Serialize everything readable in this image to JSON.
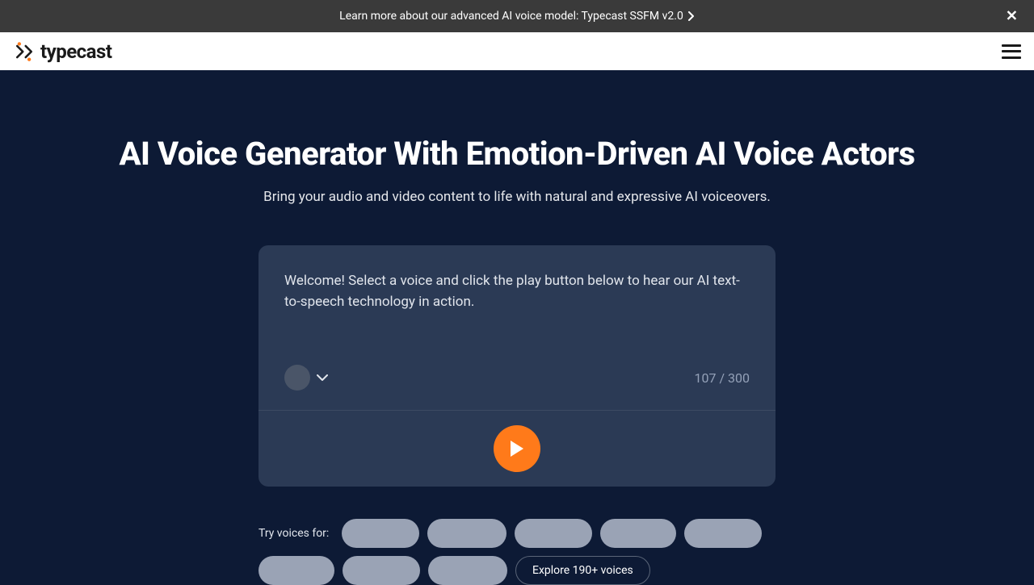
{
  "announcement": {
    "text": "Learn more about our advanced AI voice model: Typecast SSFM v2.0"
  },
  "brand": {
    "name": "typecast"
  },
  "hero": {
    "title": "AI Voice Generator With Emotion-Driven AI Voice Actors",
    "subtitle": "Bring your audio and video content to life with natural and expressive AI voiceovers."
  },
  "demo": {
    "text": "Welcome! Select a voice and click the play button below to hear our AI text-to-speech technology in action.",
    "char_count": "107 / 300"
  },
  "chips": {
    "label": "Try voices for:",
    "explore_label": "Explore 190+ voices"
  }
}
